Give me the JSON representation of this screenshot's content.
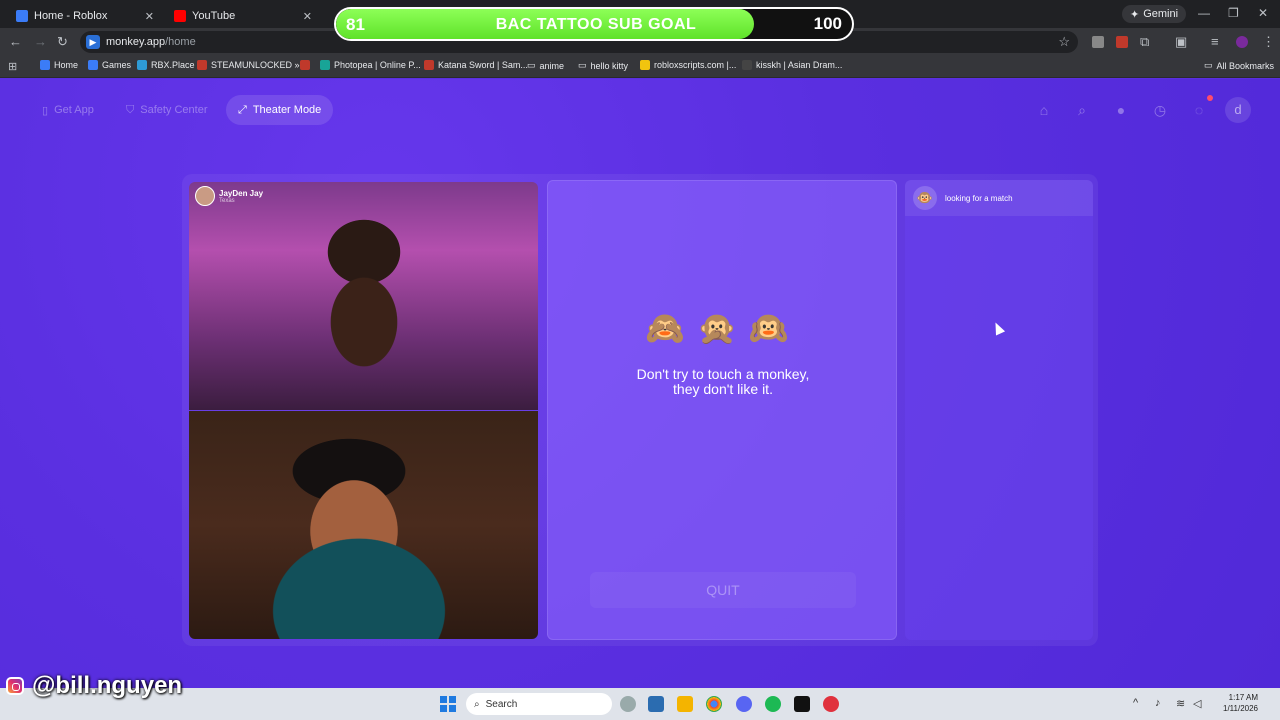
{
  "browser": {
    "tabs": [
      {
        "label": "Home - Roblox",
        "color": "#3b7cf7"
      },
      {
        "label": "YouTube",
        "color": "#ff0000"
      }
    ],
    "gemini_label": "Gemini",
    "url_host": "monkey.app",
    "url_path": "/home",
    "bookmarks": [
      "Home",
      "Games",
      "RBX.Place",
      "STEAMUNLOCKED »...",
      "Photopea | Online P...",
      "Katana Sword | Sam...",
      "anime",
      "hello kitty",
      "robloxscripts.com |...",
      "kisskh | Asian Dram..."
    ],
    "all_bookmarks_label": "All Bookmarks"
  },
  "overlay": {
    "sub_goal_title": "BAC TATTOO SUB GOAL",
    "sub_goal_current": "81",
    "sub_goal_target": "100",
    "sub_goal_progress": 0.81,
    "sub_goal_color": "#6be836"
  },
  "nav": {
    "get_app": "Get App",
    "safety_center": "Safety Center",
    "theater_mode": "Theater Mode",
    "avatar_letter": "d"
  },
  "video": {
    "caller_name": "JayDen Jay",
    "caller_location": "Texas"
  },
  "center": {
    "emojis": "🙈🙊🙉",
    "message_line1": "Don't try to touch a monkey,",
    "message_line2": "they don't like it.",
    "quit_label": "QUIT"
  },
  "chat": {
    "status": "looking for a match",
    "icon": "🐵"
  },
  "watermark": {
    "handle": "@bill.nguyen"
  },
  "taskbar": {
    "search_placeholder": "Search",
    "time": "1:17 AM",
    "date": "1/11/2026"
  },
  "colors": {
    "page_bg": "#5a2fe0",
    "accent": "#8c64ff"
  }
}
